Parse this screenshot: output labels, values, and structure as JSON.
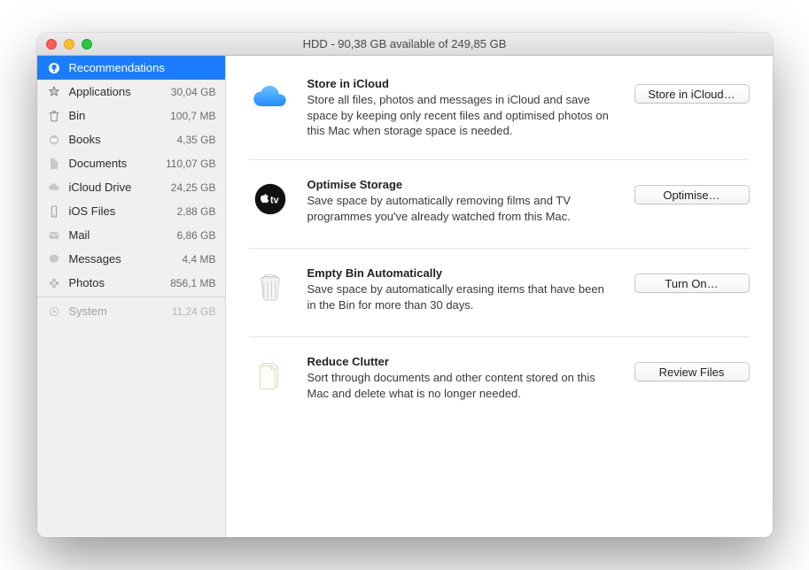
{
  "window": {
    "title": "HDD - 90,38 GB available of 249,85 GB"
  },
  "sidebar": {
    "items": [
      {
        "label": "Recommendations",
        "size": "",
        "icon": "lightbulb-icon",
        "selected": true
      },
      {
        "label": "Applications",
        "size": "30,04 GB",
        "icon": "applications-icon"
      },
      {
        "label": "Bin",
        "size": "100,7 MB",
        "icon": "bin-icon"
      },
      {
        "label": "Books",
        "size": "4,35 GB",
        "icon": "books-icon"
      },
      {
        "label": "Documents",
        "size": "110,07 GB",
        "icon": "documents-icon"
      },
      {
        "label": "iCloud Drive",
        "size": "24,25 GB",
        "icon": "icloud-icon"
      },
      {
        "label": "iOS Files",
        "size": "2,88 GB",
        "icon": "iphone-icon"
      },
      {
        "label": "Mail",
        "size": "6,86 GB",
        "icon": "mail-icon"
      },
      {
        "label": "Messages",
        "size": "4,4 MB",
        "icon": "messages-icon"
      },
      {
        "label": "Photos",
        "size": "856,1 MB",
        "icon": "photos-icon"
      }
    ],
    "system": {
      "label": "System",
      "size": "11,24 GB",
      "icon": "system-icon"
    }
  },
  "recommendations": [
    {
      "title": "Store in iCloud",
      "desc": "Store all files, photos and messages in iCloud and save space by keeping only recent files and optimised photos on this Mac when storage space is needed.",
      "button": "Store in iCloud…",
      "icon": "cloud"
    },
    {
      "title": "Optimise Storage",
      "desc": "Save space by automatically removing films and TV programmes you've already watched from this Mac.",
      "button": "Optimise…",
      "icon": "tv"
    },
    {
      "title": "Empty Bin Automatically",
      "desc": "Save space by automatically erasing items that have been in the Bin for more than 30 days.",
      "button": "Turn On…",
      "icon": "trash"
    },
    {
      "title": "Reduce Clutter",
      "desc": "Sort through documents and other content stored on this Mac and delete what is no longer needed.",
      "button": "Review Files",
      "icon": "docs"
    }
  ]
}
